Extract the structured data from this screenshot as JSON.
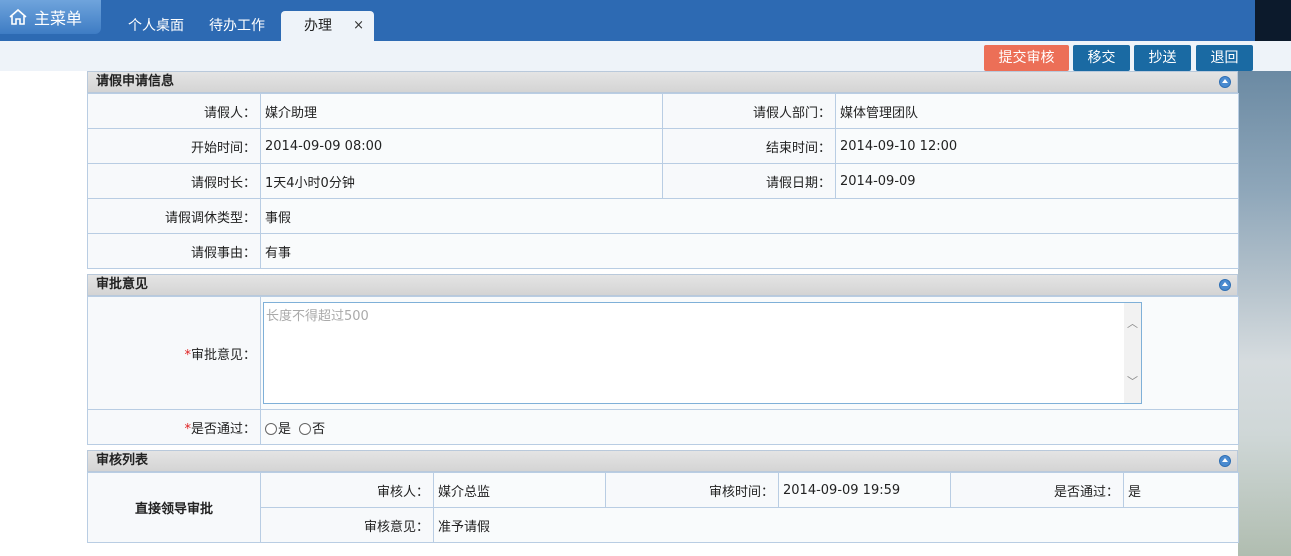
{
  "nav": {
    "home_label": "主菜单",
    "tabs": [
      {
        "label": "个人桌面"
      },
      {
        "label": "待办工作"
      },
      {
        "label": "办理",
        "close": "×"
      }
    ]
  },
  "toolbar": {
    "submit": "提交审核",
    "transfer": "移交",
    "cc": "抄送",
    "return": "退回"
  },
  "leave_info": {
    "title": "请假申请信息",
    "applicant_label": "请假人：",
    "applicant": "媒介助理",
    "dept_label": "请假人部门：",
    "dept": "媒体管理团队",
    "start_label": "开始时间：",
    "start": "2014-09-09 08:00",
    "end_label": "结束时间：",
    "end": "2014-09-10 12:00",
    "duration_label": "请假时长：",
    "duration": "1天4小时0分钟",
    "date_label": "请假日期：",
    "date": "2014-09-09",
    "type_label": "请假调休类型：",
    "type": "事假",
    "reason_label": "请假事由：",
    "reason": "有事"
  },
  "approval": {
    "title": "审批意见",
    "required": "*",
    "opinion_label": "审批意见：",
    "opinion_placeholder": "长度不得超过500",
    "pass_label": "是否通过：",
    "yes": "是",
    "no": "否"
  },
  "review_list": {
    "title": "审核列表",
    "step": "直接领导审批",
    "reviewer_label": "审核人：",
    "reviewer": "媒介总监",
    "time_label": "审核时间：",
    "time": "2014-09-09 19:59",
    "passed_label": "是否通过：",
    "passed": "是",
    "comment_label": "审核意见：",
    "comment": "准予请假"
  }
}
